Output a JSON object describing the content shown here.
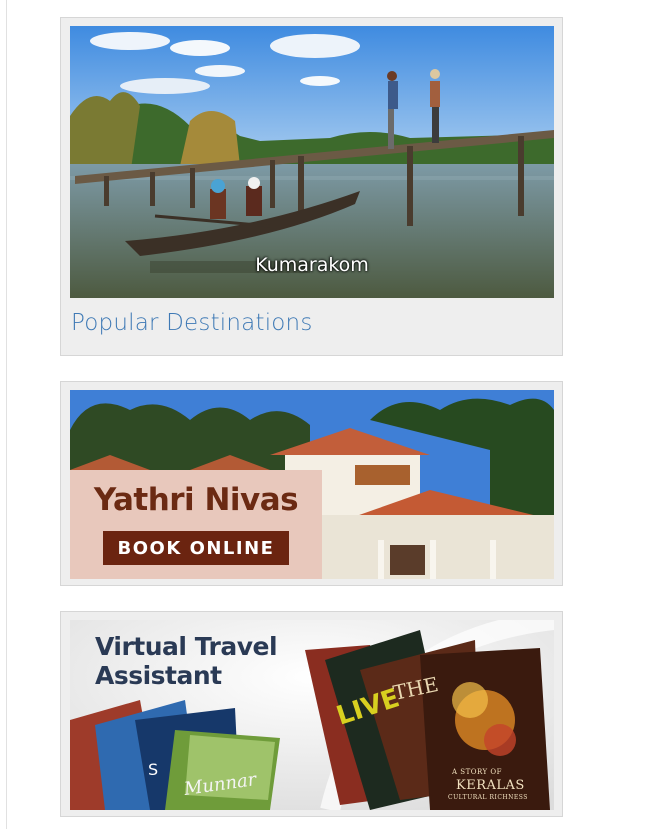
{
  "destinations_card": {
    "photo_caption": "Kumarakom",
    "link_label": "Popular Destinations"
  },
  "yathri_card": {
    "title": "Yathri Nivas",
    "button_label": "BOOK ONLINE"
  },
  "assistant_card": {
    "title_line1": "Virtual Travel",
    "title_line2": "Assistant",
    "cover_title": "KERALAS",
    "cover_subtitle": "CULTURAL RICHNESS",
    "cover_small": "A STORY OF",
    "booklet_word": "LIVE",
    "booklet_word2": "THE",
    "booklet_script": "Munnar",
    "booklet_word3": "S"
  },
  "colors": {
    "link": "#3e79b5",
    "nivas_panel": "#e8c8bc",
    "nivas_title": "#6b2a13",
    "button_bg": "#6b2410",
    "assistant_title": "#2a3a55"
  }
}
